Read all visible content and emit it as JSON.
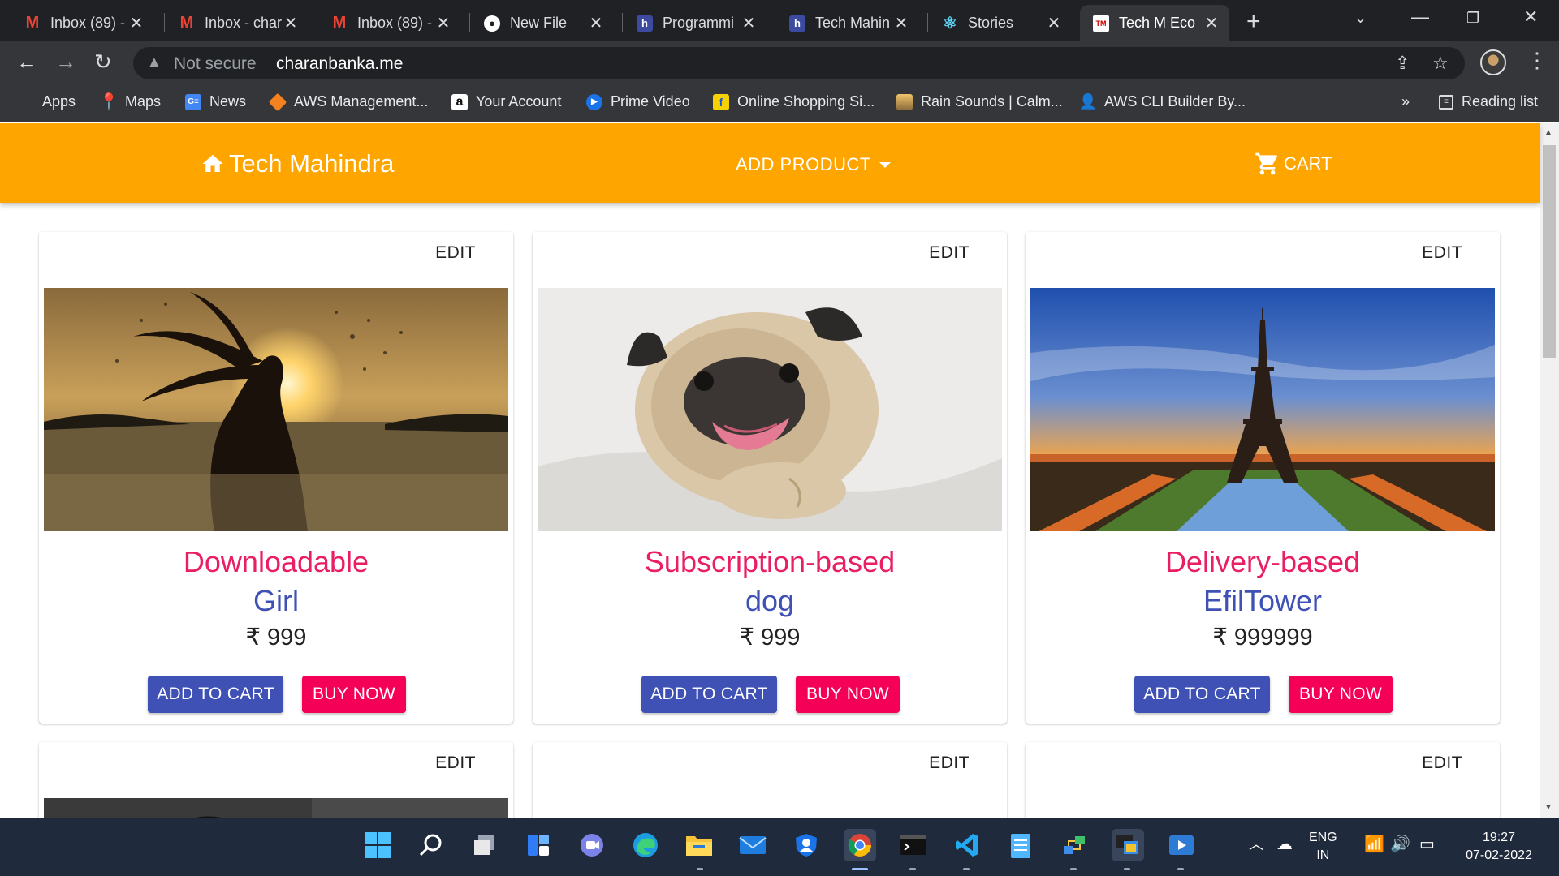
{
  "browser": {
    "tabs": [
      {
        "title": "Inbox (89) -",
        "icon": "gmail-icon"
      },
      {
        "title": "Inbox - char",
        "icon": "gmail-icon"
      },
      {
        "title": "Inbox (89) -",
        "icon": "gmail-icon"
      },
      {
        "title": "New File",
        "icon": "github-icon"
      },
      {
        "title": "Programmi",
        "icon": "hackerrank-icon"
      },
      {
        "title": "Tech Mahin",
        "icon": "hackerrank-icon"
      },
      {
        "title": "Stories",
        "icon": "react-icon"
      },
      {
        "title": "Tech M Eco",
        "icon": "techm-icon",
        "active": true
      }
    ],
    "security_label": "Not secure",
    "url": "charanbanka.me",
    "bookmarks": [
      {
        "label": "Apps",
        "icon": "apps-grid-icon"
      },
      {
        "label": "Maps",
        "icon": "maps-pin-icon"
      },
      {
        "label": "News",
        "icon": "google-news-icon"
      },
      {
        "label": "AWS Management...",
        "icon": "aws-cube-icon"
      },
      {
        "label": "Your Account",
        "icon": "amazon-icon"
      },
      {
        "label": "Prime Video",
        "icon": "prime-video-icon"
      },
      {
        "label": "Online Shopping Si...",
        "icon": "flipkart-icon"
      },
      {
        "label": "Rain Sounds | Calm...",
        "icon": "landscape-icon"
      },
      {
        "label": "AWS CLI Builder By...",
        "icon": "person-icon"
      }
    ],
    "more_bookmarks": "»",
    "reading_list": "Reading list"
  },
  "app": {
    "brand": "Tech Mahindra",
    "add_product": "ADD PRODUCT",
    "cart": "CART",
    "colors": {
      "appbar": "#ffa500",
      "primary": "#3f51b5",
      "accent": "#f50057",
      "type_text": "#e91e63"
    }
  },
  "products": [
    {
      "edit": "EDIT",
      "type": "Downloadable",
      "name": "Girl",
      "price": "₹ 999",
      "add_to_cart": "ADD TO CART",
      "buy_now": "BUY NOW",
      "image": "silhouette-sunset-water-photo"
    },
    {
      "edit": "EDIT",
      "type": "Subscription-based",
      "name": "dog",
      "price": "₹ 999",
      "add_to_cart": "ADD TO CART",
      "buy_now": "BUY NOW",
      "image": "pug-dog-photo"
    },
    {
      "edit": "EDIT",
      "type": "Delivery-based",
      "name": "EfilTower",
      "price": "₹ 999999",
      "add_to_cart": "ADD TO CART",
      "buy_now": "BUY NOW",
      "image": "eiffel-tower-sunset-photo"
    },
    {
      "edit": "EDIT"
    },
    {
      "edit": "EDIT"
    },
    {
      "edit": "EDIT"
    }
  ],
  "taskbar": {
    "apps": [
      "windows-start-icon",
      "search-icon",
      "task-view-icon",
      "widgets-icon",
      "teams-chat-icon",
      "edge-icon",
      "file-explorer-icon",
      "mail-icon",
      "user-shield-icon",
      "chrome-icon",
      "terminal-icon",
      "vscode-icon",
      "notepad-icon",
      "network-tool-icon",
      "remote-desktop-icon",
      "media-player-icon"
    ],
    "language": "ENG",
    "region": "IN",
    "time": "19:27",
    "date": "07-02-2022"
  }
}
